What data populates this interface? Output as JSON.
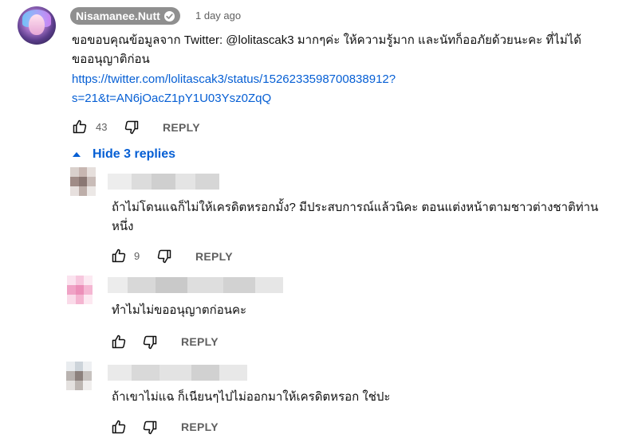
{
  "main_comment": {
    "author": "Nisamanee.Nutt",
    "timestamp": "1 day ago",
    "text_line1": "ขอขอบคุณข้อมูลจาก Twitter: @lolitascak3  มากๆค่ะ ให้ความรู้มาก และนัทก็ออภัยด้วยนะคะ ที่ไม่ได้",
    "text_line2": "ขออนุญาติก่อน",
    "link_line1": "https://twitter.com/lolitascak3/status/1526233598700838912?",
    "link_line2": "s=21&t=AN6jOacZ1pY1U03Ysz0ZqQ",
    "like_count": "43",
    "reply_label": "REPLY"
  },
  "replies_toggle": {
    "label": "Hide 3 replies"
  },
  "replies": [
    {
      "text_line1": "ถ้าไม่โดนแฉก็ไม่ให้เครดิตหรอกมั้ง? มีประสบการณ์แล้วนิคะ ตอนแต่งหน้าตามชาวต่างชาติท่าน",
      "text_line2": "หนึ่ง",
      "like_count": "9",
      "reply_label": "REPLY"
    },
    {
      "text_line1": "ทำไมไม่ขออนุญาตก่อนคะ",
      "like_count": "",
      "reply_label": "REPLY"
    },
    {
      "text_line1": "ถ้าเขาไม่แฉ ก็เนียนๆไปไม่ออกมาให้เครดิตหรอก ใช่ปะ",
      "like_count": "",
      "reply_label": "REPLY"
    }
  ],
  "icons": {
    "like": "thumbs-up-icon",
    "dislike": "thumbs-down-icon",
    "verified": "verified-check-icon",
    "toggle": "caret-up-icon"
  },
  "colors": {
    "link": "#065fd4",
    "secondary_text": "#606060",
    "author_chip": "#8f8f8f"
  }
}
